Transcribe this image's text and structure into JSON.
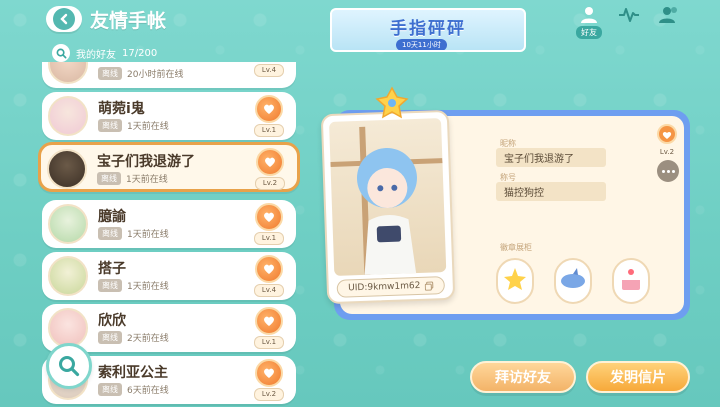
{
  "header": {
    "title": "友情手帐",
    "friend_count_label": "我的好友",
    "friend_count_value": "17/200"
  },
  "event": {
    "title": "手指砰砰",
    "timer": "10天11小时"
  },
  "tabs": {
    "friends_label": "好友"
  },
  "friends": [
    {
      "name": "",
      "status": "离线",
      "last_online": "20小时前在线",
      "level": "Lv.4"
    },
    {
      "name": "萌菀i鬼",
      "status": "离线",
      "last_online": "1天前在线",
      "level": "Lv.1"
    },
    {
      "name": "宝子们我退游了",
      "status": "离线",
      "last_online": "1天前在线",
      "level": "Lv.2"
    },
    {
      "name": "臆諭",
      "status": "离线",
      "last_online": "1天前在线",
      "level": "Lv.1"
    },
    {
      "name": "搭子",
      "status": "离线",
      "last_online": "1天前在线",
      "level": "Lv.4"
    },
    {
      "name": "欣欣",
      "status": "离线",
      "last_online": "2天前在线",
      "level": "Lv.1"
    },
    {
      "name": "索利亚公主",
      "status": "离线",
      "last_online": "6天前在线",
      "level": "Lv.2"
    }
  ],
  "profile": {
    "uid": "UID:9kmw1m62",
    "nickname_label": "昵称",
    "nickname": "宝子们我退游了",
    "title_label": "称号",
    "title": "猫控狗控",
    "decorations_label": "徽章展柜",
    "level": "Lv.2"
  },
  "actions": {
    "visit": "拜访好友",
    "postcard": "发明信片"
  },
  "colors": {
    "background": "#6fcfc4",
    "card_border": "#6e9ef0",
    "selected_border": "#e8a24a",
    "accent_orange": "#f7a93a"
  }
}
